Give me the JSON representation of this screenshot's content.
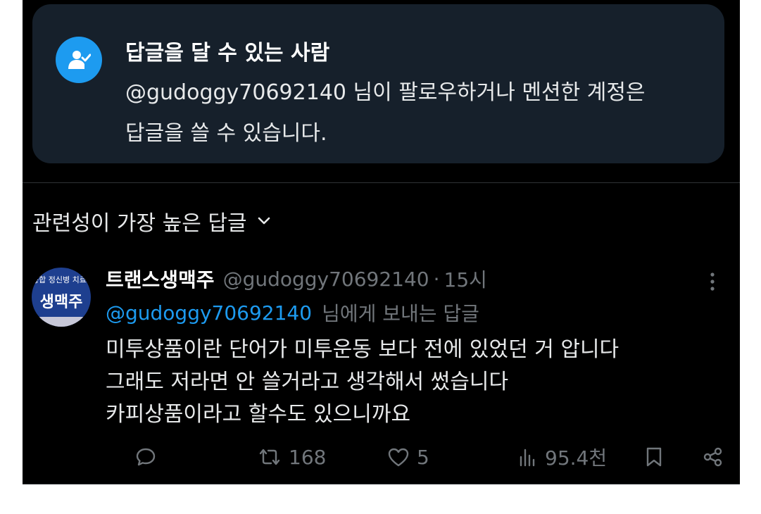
{
  "who_can_reply": {
    "icon": "user-check-icon",
    "title": "답글을 달 수 있는 사람",
    "line1": "@gudoggy70692140 님이 팔로우하거나 멘션한 계정은",
    "line2": "답글을 쓸 수 있습니다."
  },
  "sort": {
    "label": "관련성이 가장 높은 답글",
    "icon": "chevron-down-icon"
  },
  "reply": {
    "avatar": {
      "top_text": "종합 정신병 치료제",
      "main_text": "생맥주"
    },
    "display_name": "트랜스생맥주",
    "handle": "@gudoggy70692140",
    "separator": "·",
    "time": "15시",
    "reply_to_mention": "@gudoggy70692140",
    "reply_to_suffix": "님에게 보내는 답글",
    "text_lines": [
      "미투상품이란 단어가 미투운동 보다 전에 있었던 거 압니다",
      "그래도 저라면 안 쓸거라고 생각해서 썼습니다",
      "카피상품이라고 할수도 있으니까요"
    ],
    "stats": {
      "retweets": "168",
      "likes": "5",
      "views": "95.4천"
    }
  },
  "colors": {
    "background": "#000000",
    "card": "#16202b",
    "accent": "#1d9bf0",
    "muted": "#71767b",
    "text": "#e7e9ea"
  }
}
